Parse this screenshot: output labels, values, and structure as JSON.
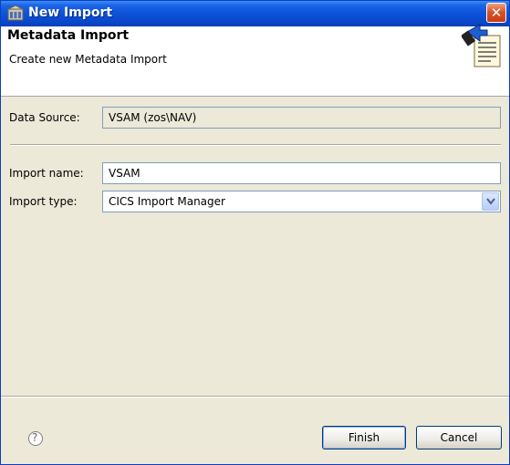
{
  "window": {
    "title": "New Import",
    "close_label": "✕"
  },
  "banner": {
    "heading": "Metadata Import",
    "description": "Create new Metadata Import"
  },
  "form": {
    "data_source_label": "Data Source:",
    "data_source_value": "VSAM (zos\\NAV)",
    "import_name_label": "Import name:",
    "import_name_value": "VSAM",
    "import_type_label": "Import type:",
    "import_type_value": "CICS Import Manager"
  },
  "footer": {
    "help_label": "?",
    "finish_label": "Finish",
    "cancel_label": "Cancel"
  }
}
